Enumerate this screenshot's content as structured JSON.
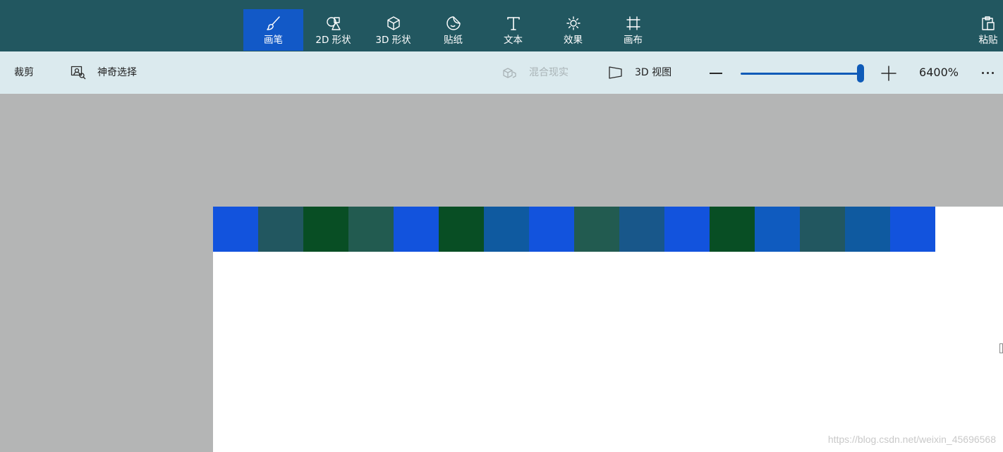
{
  "toolbar": {
    "tools": [
      {
        "id": "brushes",
        "label": "画笔",
        "icon": "brush-icon",
        "active": true
      },
      {
        "id": "2d-shapes",
        "label": "2D 形状",
        "icon": "2d-shapes-icon",
        "active": false
      },
      {
        "id": "3d-shapes",
        "label": "3D 形状",
        "icon": "3d-shapes-icon",
        "active": false
      },
      {
        "id": "stickers",
        "label": "贴纸",
        "icon": "sticker-icon",
        "active": false
      },
      {
        "id": "text",
        "label": "文本",
        "icon": "text-icon",
        "active": false
      },
      {
        "id": "effects",
        "label": "效果",
        "icon": "effects-icon",
        "active": false
      },
      {
        "id": "canvas",
        "label": "画布",
        "icon": "canvas-icon",
        "active": false
      }
    ],
    "paste": {
      "label": "粘贴",
      "icon": "paste-icon"
    }
  },
  "subbar": {
    "crop": {
      "label": "裁剪"
    },
    "magic_select": {
      "label": "神奇选择",
      "icon": "magic-select-icon"
    },
    "mixed_reality": {
      "label": "混合现实",
      "icon": "mixed-reality-icon",
      "enabled": false
    },
    "view_3d": {
      "label": "3D 视图",
      "icon": "3d-view-icon"
    },
    "zoom": {
      "value": "6400%",
      "level": 1.0
    }
  },
  "canvas": {
    "background": "#ffffff",
    "pixel_colors": [
      "#1253dd",
      "#225760",
      "#084e24",
      "#225b50",
      "#1253dd",
      "#084e24",
      "#0f5aa0",
      "#1253dd",
      "#225b50",
      "#18578a",
      "#1253dd",
      "#084e24",
      "#0f5bbf",
      "#225760",
      "#0f5aa0",
      "#1253dd"
    ]
  },
  "watermark": "https://blog.csdn.net/weixin_45696568",
  "colors": {
    "toolbar_bg": "#225760",
    "active_tool_bg": "#1259c7",
    "subbar_bg": "#dbeaee",
    "workspace_bg": "#b4b5b5",
    "accent": "#0f5bb8"
  }
}
